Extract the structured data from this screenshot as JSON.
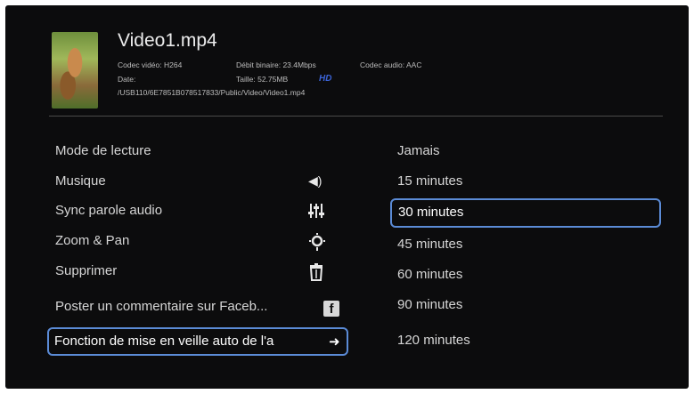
{
  "file": {
    "title": "Video1.mp4",
    "video_codec": "Codec vidéo: H264",
    "bitrate": "Débit binaire: 23.4Mbps",
    "audio_codec": "Codec audio: AAC",
    "date": "Date:",
    "size": "Taille: 52.75MB",
    "hd_badge": "HD",
    "path": "/USB110/6E7851B078517833/Public/Video/Video1.mp4"
  },
  "menu": {
    "items": [
      {
        "label": "Mode de lecture",
        "icon": ""
      },
      {
        "label": "Musique",
        "icon": "speaker-icon"
      },
      {
        "label": "Sync parole audio",
        "icon": "equalizer-icon"
      },
      {
        "label": "Zoom & Pan",
        "icon": "zoom-icon"
      },
      {
        "label": "Supprimer",
        "icon": "trash-icon"
      },
      {
        "label": "Poster un commentaire sur Faceb...",
        "icon": "facebook-icon"
      },
      {
        "label": "Fonction de mise en veille auto de l'a",
        "icon": "arrow-right-icon"
      }
    ],
    "selected_index": 6
  },
  "options": {
    "items": [
      "Jamais",
      "15 minutes",
      "30 minutes",
      "45 minutes",
      "60 minutes",
      "90 minutes",
      "120 minutes"
    ],
    "selected_index": 2
  },
  "colors": {
    "background": "#0c0c0d",
    "highlight": "#5b8bd6",
    "hd": "#3b63d6"
  }
}
